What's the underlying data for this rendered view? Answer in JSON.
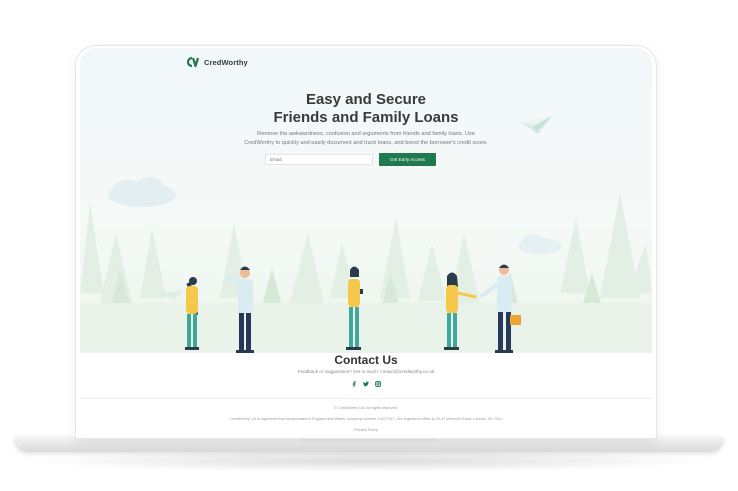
{
  "brand": {
    "name": "CredWorthy",
    "color": "#1f7b4d"
  },
  "hero": {
    "title_line1": "Easy and Secure",
    "title_line2": "Friends and Family Loans",
    "subtitle_line1": "Remove the awkwardness, confusion and arguments from friends and family loans. Use",
    "subtitle_line2": "CredWorthy to quickly and easily document and track loans, and boost the borrower's credit score.",
    "email_placeholder": "Email",
    "cta_label": "Get Early Access"
  },
  "contact": {
    "title": "Contact Us",
    "subtitle": "Feedback or suggestions? Get in touch: contact@credworthy.co.uk",
    "social_icons": [
      "facebook-icon",
      "twitter-icon",
      "instagram-icon"
    ]
  },
  "footer": {
    "copyright": "© CredWorthy Ltd. All rights reserved.",
    "registration": "CredWorthy Ltd is registered and incorporated in England and Wales, company number 12477137. Our registered office is 20-22 Wenlock Road, London, N1 7GU.",
    "privacy_label": "Privacy Policy"
  }
}
